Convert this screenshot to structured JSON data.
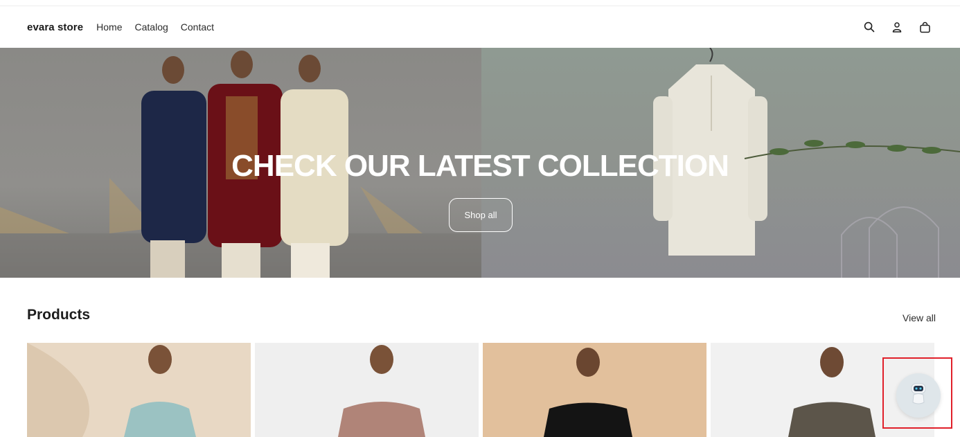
{
  "header": {
    "brand": "evara store",
    "nav": [
      {
        "label": "Home"
      },
      {
        "label": "Catalog"
      },
      {
        "label": "Contact"
      }
    ],
    "icons": [
      "search-icon",
      "account-icon",
      "cart-bag-icon"
    ]
  },
  "hero": {
    "title": "CHECK OUR LATEST COLLECTION",
    "button_label": "Shop all"
  },
  "products": {
    "title": "Products",
    "view_all_label": "View all",
    "items": [
      {
        "name": "product-card-1"
      },
      {
        "name": "product-card-2"
      },
      {
        "name": "product-card-3"
      },
      {
        "name": "product-card-4"
      }
    ]
  },
  "chat_widget": {
    "icon": "chatbot-robot-icon"
  },
  "colors": {
    "text": "#1f1f1f",
    "highlight": "#e0202a",
    "chat_bg": "#dfe6ea"
  }
}
